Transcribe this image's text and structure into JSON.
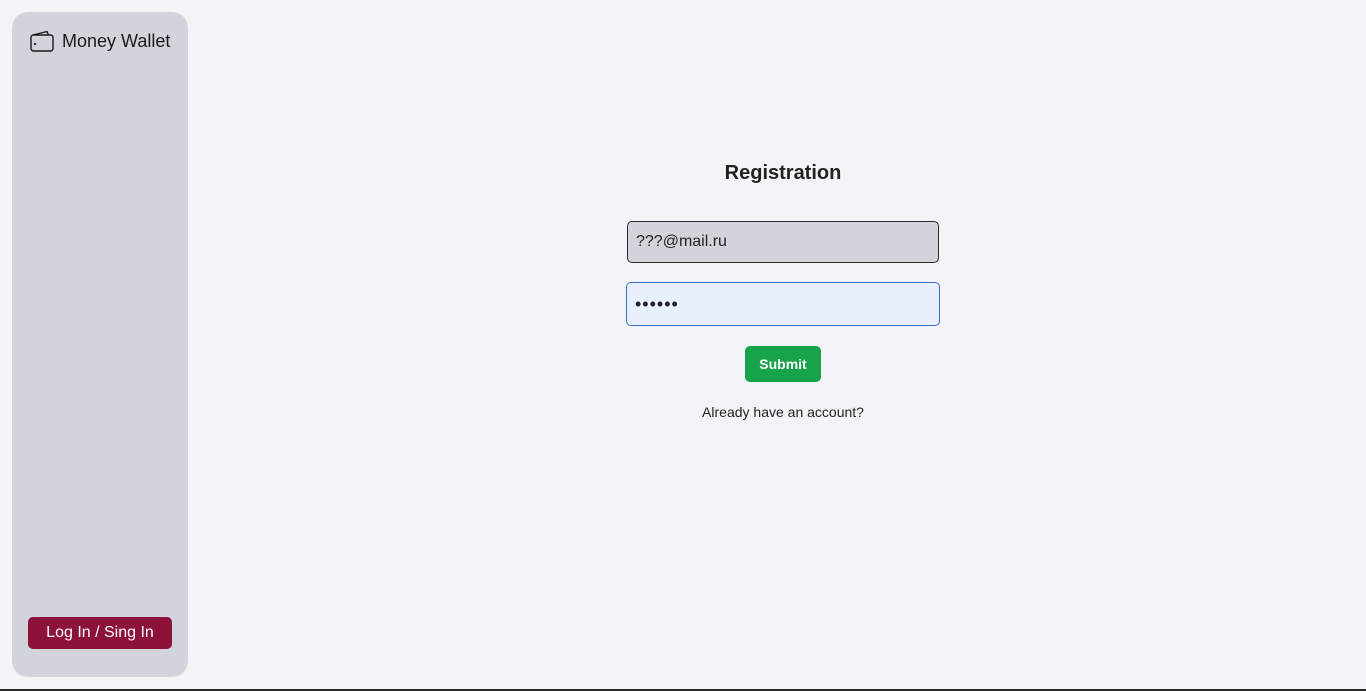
{
  "sidebar": {
    "brand": {
      "icon": "wallet-icon",
      "title": "Money Wallet"
    },
    "login_button_label": "Log In / Sing In"
  },
  "form": {
    "title": "Registration",
    "email_value": "???@mail.ru",
    "password_value": "••••••",
    "submit_label": "Submit",
    "account_link": "Already have an account?"
  },
  "colors": {
    "page_bg": "#f3f4f6",
    "sidebar_bg": "#d1d5db",
    "login_button_bg": "#8c1239",
    "submit_button_bg": "#16a34a",
    "password_field_bg": "#e8f0fe",
    "password_field_border": "#3b6fc9"
  }
}
